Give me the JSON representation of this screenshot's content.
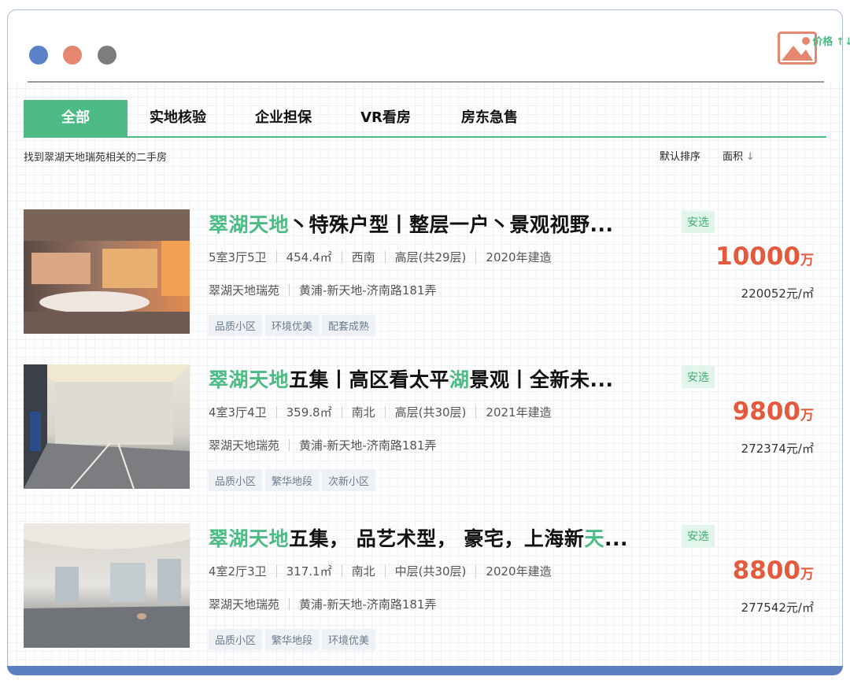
{
  "tabs": [
    "全部",
    "实地核验",
    "企业担保",
    "VR看房",
    "房东急售"
  ],
  "search_summary": "找到翠湖天地瑞苑相关的二手房",
  "sort": {
    "default": "默认排序",
    "area": "面积",
    "area_arrow": "↓",
    "price": "价格",
    "price_arrow": "↑↓"
  },
  "accent_color": "#4cbb84",
  "price_color": "#e45a3c",
  "listings": [
    {
      "title_highlight": "翠湖天地",
      "title_rest": "丶特殊户型丨整层一户丶景观视野...",
      "badge": "安选",
      "layout": "5室3厅5卫",
      "area": "454.4㎡",
      "orientation": "西南",
      "floor": "高层(共29层)",
      "built": "2020年建造",
      "community": "翠湖天地瑞苑",
      "location": "黄浦-新天地-济南路181弄",
      "tags": [
        "品质小区",
        "环境优美",
        "配套成熟"
      ],
      "price": "10000",
      "price_unit": "万",
      "unit_price": "220052元/㎡"
    },
    {
      "title_highlight": "翠湖天地",
      "title_mid": "五集丨高区看太平",
      "title_highlight2": "湖",
      "title_rest": "景观丨全新未...",
      "badge": "安选",
      "layout": "4室3厅4卫",
      "area": "359.8㎡",
      "orientation": "南北",
      "floor": "高层(共30层)",
      "built": "2021年建造",
      "community": "翠湖天地瑞苑",
      "location": "黄浦-新天地-济南路181弄",
      "tags": [
        "品质小区",
        "繁华地段",
        "次新小区"
      ],
      "price": "9800",
      "price_unit": "万",
      "unit_price": "272374元/㎡"
    },
    {
      "title_highlight": "翠湖天地",
      "title_mid": "五集， 品艺术型， 豪宅，上海新",
      "title_highlight2": "天",
      "title_rest": "...",
      "badge": "安选",
      "layout": "4室2厅3卫",
      "area": "317.1㎡",
      "orientation": "南北",
      "floor": "中层(共30层)",
      "built": "2020年建造",
      "community": "翠湖天地瑞苑",
      "location": "黄浦-新天地-济南路181弄",
      "tags": [
        "品质小区",
        "繁华地段",
        "环境优美"
      ],
      "price": "8800",
      "price_unit": "万",
      "unit_price": "277542元/㎡"
    }
  ]
}
